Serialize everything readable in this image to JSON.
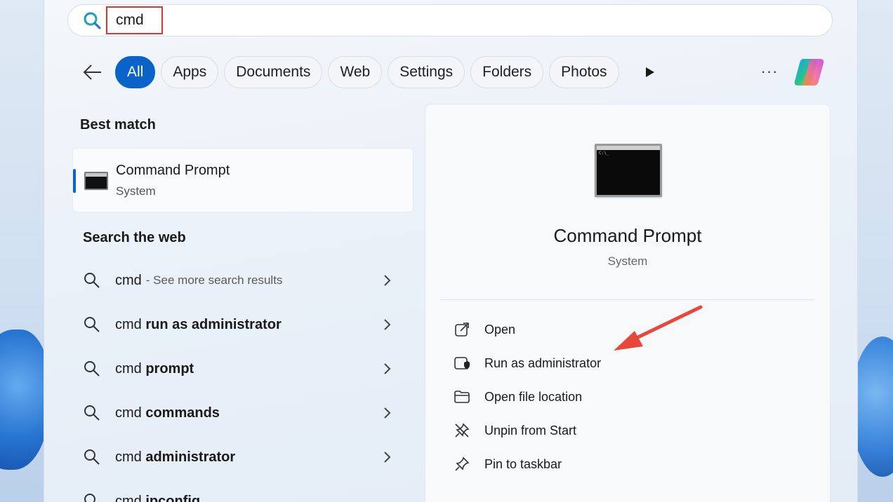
{
  "search": {
    "value": "cmd"
  },
  "filters": {
    "items": [
      {
        "label": "All",
        "active": true
      },
      {
        "label": "Apps"
      },
      {
        "label": "Documents"
      },
      {
        "label": "Web"
      },
      {
        "label": "Settings"
      },
      {
        "label": "Folders"
      },
      {
        "label": "Photos"
      }
    ]
  },
  "best_match": {
    "heading": "Best match",
    "title": "Command Prompt",
    "subtitle": "System",
    "icon": "cmd-icon"
  },
  "search_web": {
    "heading": "Search the web",
    "items": [
      {
        "query": "cmd",
        "bold": "",
        "hint": "- See more search results"
      },
      {
        "query": "cmd ",
        "bold": "run as administrator",
        "hint": ""
      },
      {
        "query": "cmd ",
        "bold": "prompt",
        "hint": ""
      },
      {
        "query": "cmd ",
        "bold": "commands",
        "hint": ""
      },
      {
        "query": "cmd ",
        "bold": "administrator",
        "hint": ""
      },
      {
        "query": "cmd ",
        "bold": "ipconfig",
        "hint": ""
      }
    ]
  },
  "preview": {
    "title": "Command Prompt",
    "subtitle": "System",
    "actions": [
      {
        "label": "Open",
        "icon": "open-external-icon"
      },
      {
        "label": "Run as administrator",
        "icon": "shield-icon"
      },
      {
        "label": "Open file location",
        "icon": "folder-icon"
      },
      {
        "label": "Unpin from Start",
        "icon": "unpin-icon"
      },
      {
        "label": "Pin to taskbar",
        "icon": "pin-icon"
      }
    ]
  },
  "colors": {
    "accent": "#0a63c9",
    "highlight": "#e0352b",
    "annotation_arrow": "#e8473a"
  }
}
